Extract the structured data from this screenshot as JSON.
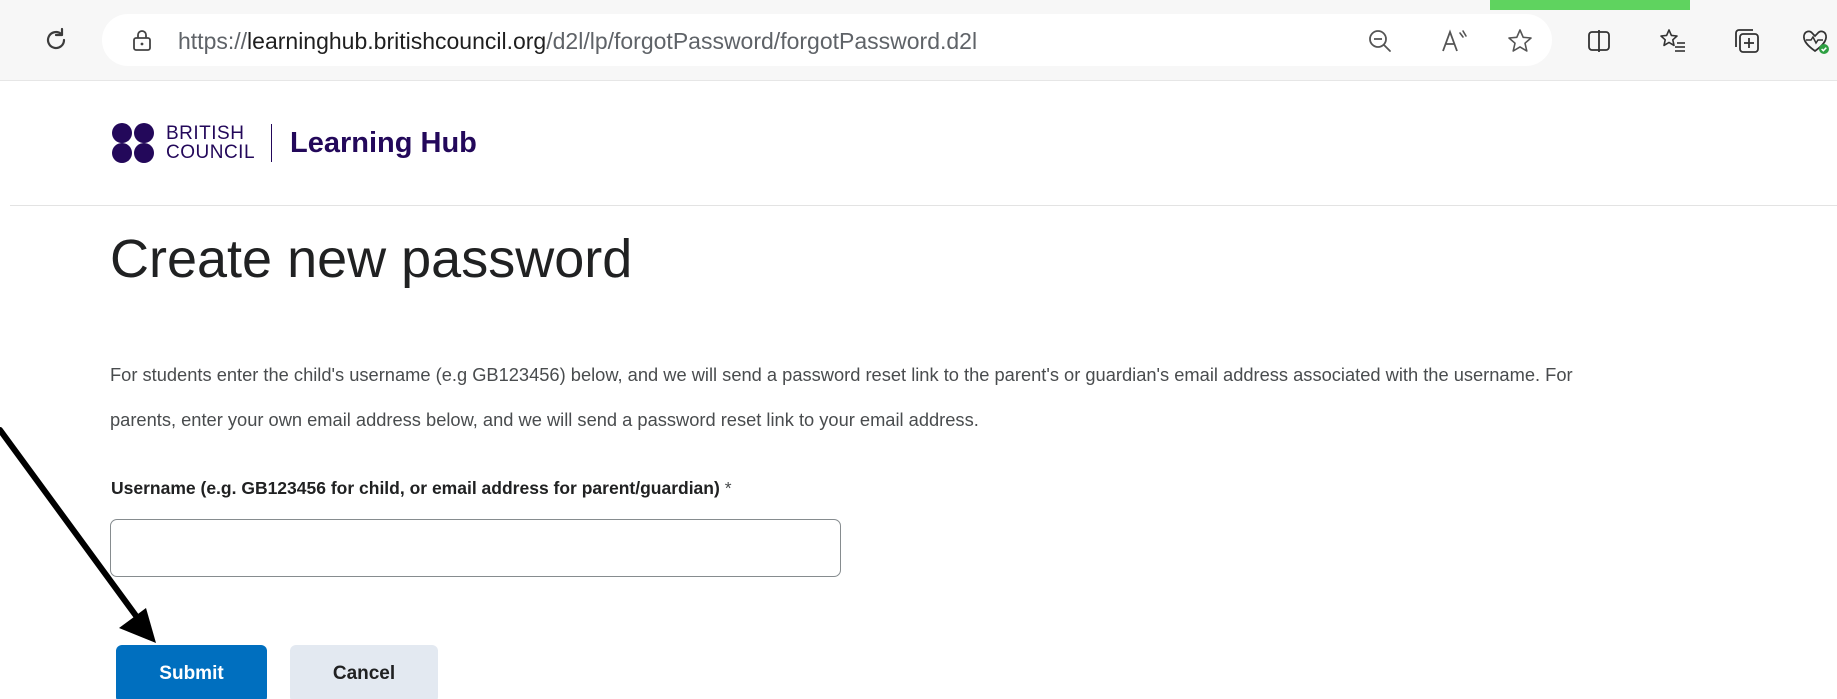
{
  "browser": {
    "url_prefix": "https://",
    "url_host": "learninghub.britishcouncil.org",
    "url_path": "/d2l/lp/forgotPassword/forgotPassword.d2l",
    "toolbar_icons": [
      "reload-icon",
      "lock-icon",
      "zoom-out-icon",
      "read-aloud-icon",
      "favorite-star-icon",
      "split-screen-icon",
      "favorites-list-icon",
      "collections-icon",
      "browser-essentials-icon"
    ],
    "accent_color": "#5fd35f"
  },
  "header": {
    "logo_line1": "BRITISH",
    "logo_line2": "COUNCIL",
    "product_name": "Learning Hub",
    "brand_color": "#23085a"
  },
  "main": {
    "title": "Create new password",
    "description_line1": "For students enter the child's username (e.g GB123456) below, and we will send a password reset link to the parent's or guardian's email address associated with the username. For",
    "description_line2": "parents, enter your own email address below, and we will send a password reset link to your email address.",
    "username_label": "Username (e.g. GB123456 for child, or email address for parent/guardian)",
    "required_marker": "*",
    "username_value": "",
    "submit_label": "Submit",
    "cancel_label": "Cancel",
    "submit_color": "#006fbf",
    "cancel_color": "#e3e9f1"
  }
}
